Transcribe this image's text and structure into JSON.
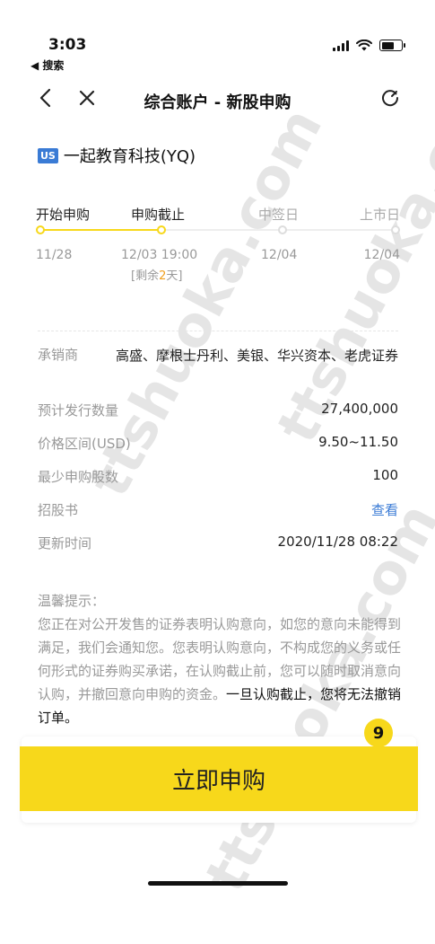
{
  "status_bar": {
    "time": "3:03",
    "back_app": "◀ 搜索"
  },
  "nav": {
    "title": "综合账户 - 新股申购"
  },
  "stock": {
    "market": "US",
    "name": "一起教育科技(YQ)"
  },
  "timeline": {
    "steps": [
      {
        "label": "开始申购",
        "date": "11/28"
      },
      {
        "label": "申购截止",
        "date": "12/03 19:00"
      },
      {
        "label": "中签日",
        "date": "12/04"
      },
      {
        "label": "上市日",
        "date": "12/04"
      }
    ],
    "remain_prefix": "[剩余",
    "remain_days": "2",
    "remain_suffix": "天]"
  },
  "info": {
    "underwriter": {
      "key": "承销商",
      "value": "高盛、摩根士丹利、美银、华兴资本、老虎证券"
    },
    "shares": {
      "key": "预计发行数量",
      "value": "27,400,000"
    },
    "price": {
      "key": "价格区间(USD)",
      "value": "9.50~11.50"
    },
    "min_shares": {
      "key": "最少申购股数",
      "value": "100"
    },
    "prospectus": {
      "key": "招股书",
      "value": "查看"
    },
    "updated": {
      "key": "更新时间",
      "value": "2020/11/28 08:22"
    }
  },
  "tips": {
    "title": "温馨提示：",
    "body": "您正在对公开发售的证券表明认购意向，如您的意向未能得到满足，我们会通知您。您表明认购意向，不构成您的义务或任何形式的证券购买承诺，在认购截止前，您可以随时取消意向认购，并撤回意向申购的资金。",
    "body2": "一旦认购截止，您将无法撤销订单。"
  },
  "action": {
    "submit_label": "立即申购",
    "badge": "9"
  },
  "watermark": "ttshuoka.com",
  "colors": {
    "accent": "#f7d81b",
    "link": "#3a7bd5",
    "muted": "#999999",
    "badge_us": "#3a7bd5"
  }
}
